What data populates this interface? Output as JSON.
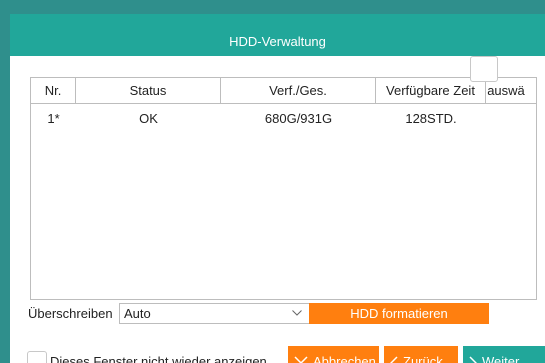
{
  "dialog": {
    "title": "HDD-Verwaltung"
  },
  "table": {
    "headers": [
      "Nr.",
      "Status",
      "Verf./Ges.",
      "Verfügbare Zeit",
      "auswä"
    ],
    "rows": [
      {
        "nr": "1*",
        "status": "OK",
        "capacity": "680G/931G",
        "time": "128STD."
      }
    ]
  },
  "overwrite": {
    "label": "Überschreiben",
    "value": "Auto"
  },
  "format_button": "HDD formatieren",
  "dont_show": "Dieses Fenster nicht wieder anzeigen",
  "buttons": {
    "cancel": "Abbrechen",
    "back": "Zurück",
    "next": "Weiter"
  },
  "colors": {
    "accent": "#21a79a",
    "orange": "#ff7f0f",
    "backdrop": "#2f8f8c"
  }
}
